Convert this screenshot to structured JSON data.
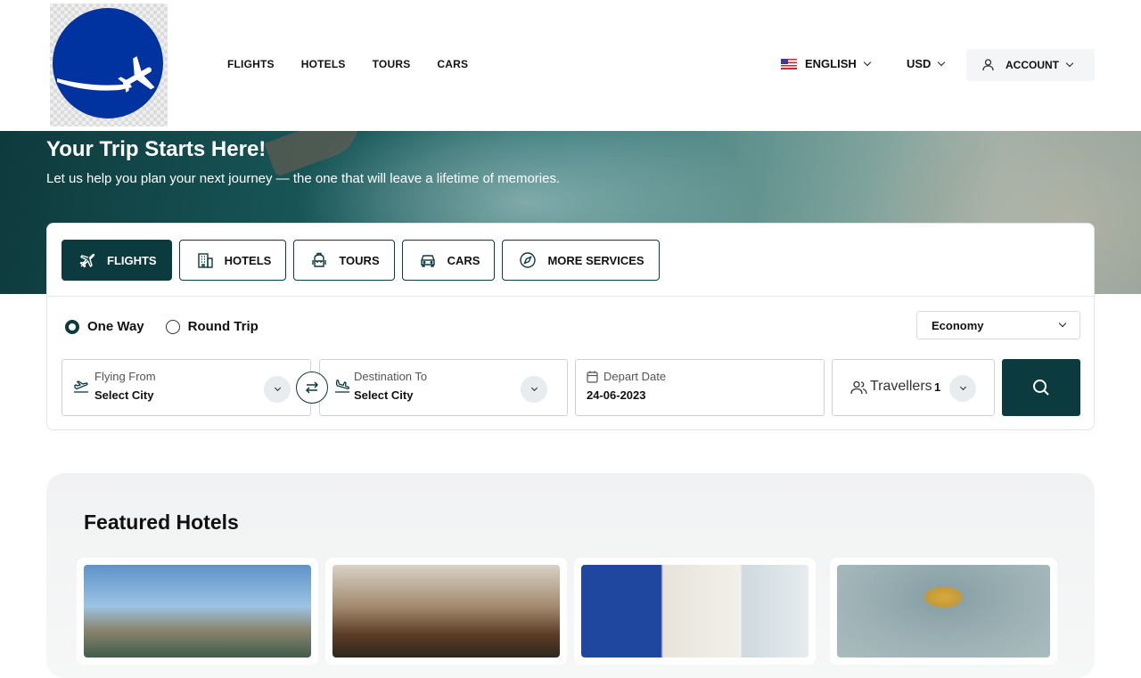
{
  "header": {
    "logo_icon": "globe-plane-logo",
    "nav": [
      "FLIGHTS",
      "HOTELS",
      "TOURS",
      "CARS"
    ],
    "language": "ENGLISH",
    "currency": "USD",
    "account": "ACCOUNT"
  },
  "hero": {
    "title": "Your Trip Starts Here!",
    "subtitle": "Let us help you plan your next journey — the one that will leave a lifetime of memories."
  },
  "tabs": {
    "flights": "FLIGHTS",
    "hotels": "HOTELS",
    "tours": "TOURS",
    "cars": "CARS",
    "more": "MORE SERVICES"
  },
  "search": {
    "trip_types": [
      "One Way",
      "Round Trip"
    ],
    "selected_trip": "One Way",
    "cabin_class": "Economy",
    "from_label": "Flying From",
    "from_value": "Select City",
    "to_label": "Destination To",
    "to_value": "Select City",
    "date_label": "Depart Date",
    "date_value": "24-06-2023",
    "travellers_label": "Travellers",
    "travellers_count": "1"
  },
  "featured": {
    "title": "Featured Hotels"
  },
  "colors": {
    "primary": "#0b3a3f",
    "logo_blue": "#0033a0"
  }
}
